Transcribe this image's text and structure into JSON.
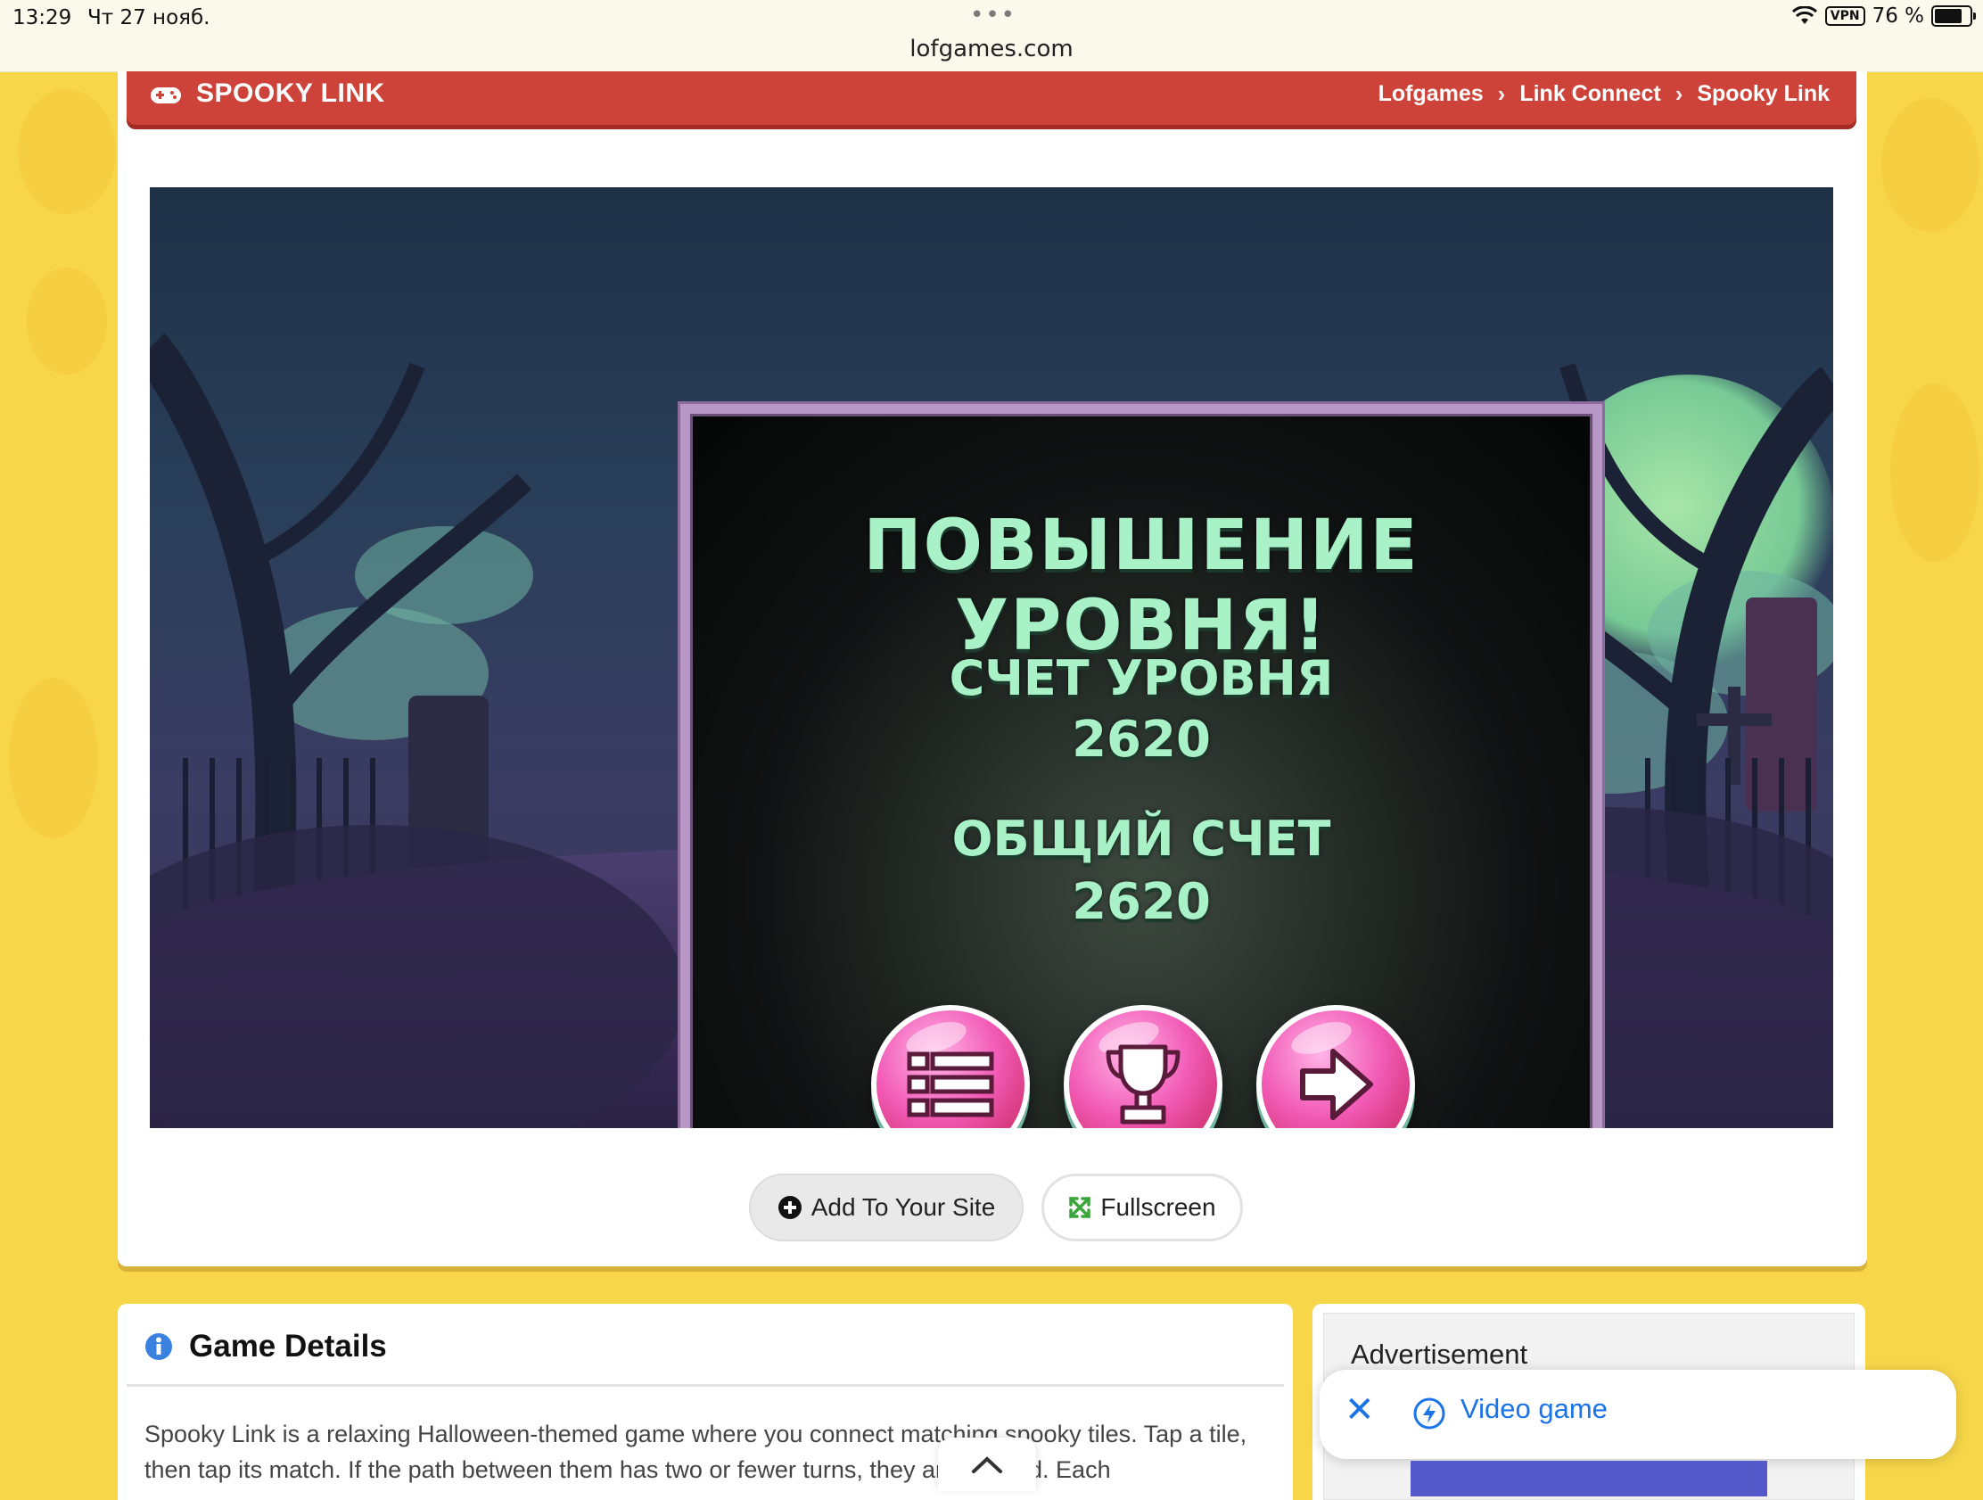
{
  "status_bar": {
    "time": "13:29",
    "date": "Чт 27 нояб.",
    "url": "lofgames.com",
    "vpn": "VPN",
    "battery": "76 %"
  },
  "header": {
    "title": "SPOOKY LINK",
    "breadcrumbs": [
      "Lofgames",
      "Link Connect",
      "Spooky Link"
    ]
  },
  "game": {
    "title": "ПОВЫШЕНИЕ УРОВНЯ!",
    "level_score_label": "СЧЕТ УРОВНЯ",
    "level_score": "2620",
    "total_score_label": "ОБЩИЙ СЧЕТ",
    "total_score": "2620",
    "buttons": [
      "menu-icon",
      "trophy-icon",
      "next-arrow-icon"
    ]
  },
  "actions": {
    "add_to_site": "Add To Your Site",
    "fullscreen": "Fullscreen"
  },
  "details": {
    "heading": "Game Details",
    "description": "Spooky Link is a relaxing Halloween-themed game where you connect matching spooky tiles. Tap a tile, then tap its match. If the path between them has two or fewer turns, they are cleared. Each"
  },
  "ad": {
    "label": "Advertisement",
    "video_label": "Video game"
  },
  "colors": {
    "page_bg": "#f7d749",
    "header_red": "#cd4339",
    "panel_text": "#a9f2c8",
    "orb_pink": "#f25bb7",
    "link_blue": "#1a73e8"
  }
}
